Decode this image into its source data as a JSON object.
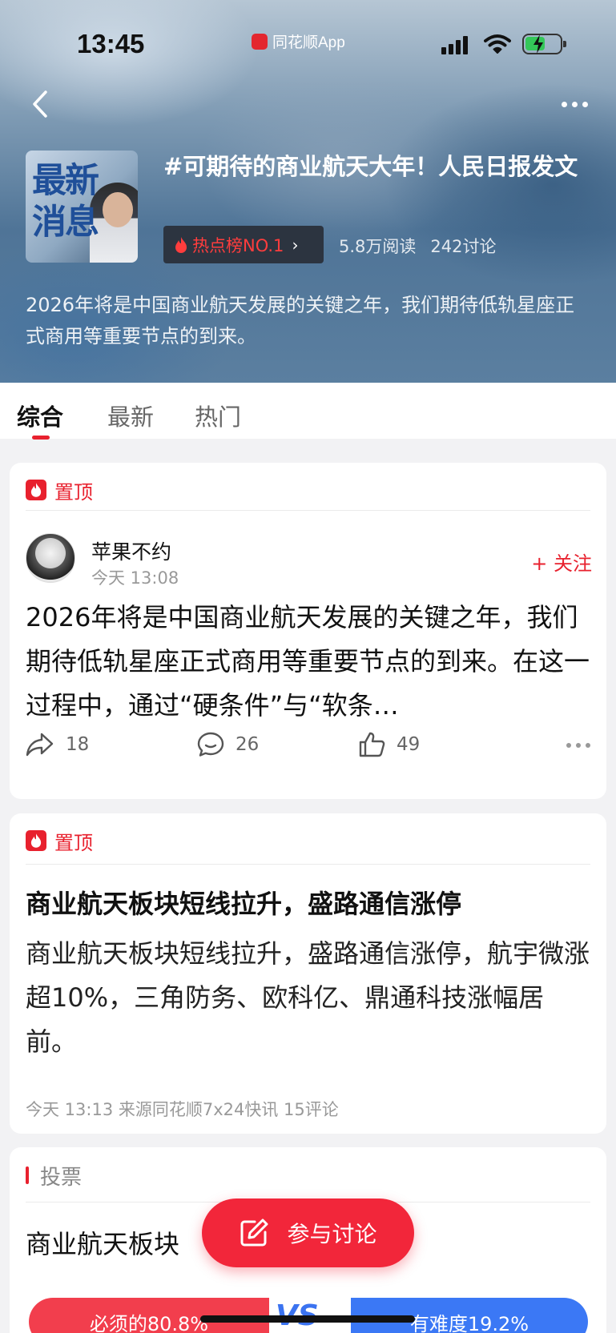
{
  "status_bar": {
    "time": "13:45",
    "app_name": "同花顺App"
  },
  "topic": {
    "thumb_text": "最新消息",
    "title": "#可期待的商业航天大年！人民日报发文",
    "hot_badge": "热点榜NO.1",
    "reads": "5.8万阅读",
    "discussions": "242讨论",
    "description": "2026年将是中国商业航天发展的关键之年，我们期待低轨星座正式商用等重要节点的到来。"
  },
  "tabs": [
    "综合",
    "最新",
    "热门"
  ],
  "active_tab": 0,
  "post1": {
    "pin_label": "置顶",
    "author": "苹果不约",
    "time": "今天 13:08",
    "follow_label": "+ 关注",
    "body": "2026年将是中国商业航天发展的关键之年，我们期待低轨星座正式商用等重要节点的到来。在这一过程中，通过“硬条件”与“软条…",
    "shares": "18",
    "comments": "26",
    "likes": "49"
  },
  "post2": {
    "pin_label": "置顶",
    "title": "商业航天板块短线拉升，盛路通信涨停",
    "body": "商业航天板块短线拉升，盛路通信涨停，航宇微涨超10%，三角防务、欧科亿、鼎通科技涨幅居前。",
    "meta": "今天 13:13 来源同花顺7x24快讯 15评论"
  },
  "vote": {
    "label": "投票",
    "question": "商业航天板块",
    "left_option": "必须的80.8%",
    "vs": "VS",
    "right_option": "有难度19.2%"
  },
  "fab_label": "参与讨论",
  "colors": {
    "accent": "#e8212e",
    "vote_blue": "#3b78f5",
    "fab": "#f2263a"
  }
}
